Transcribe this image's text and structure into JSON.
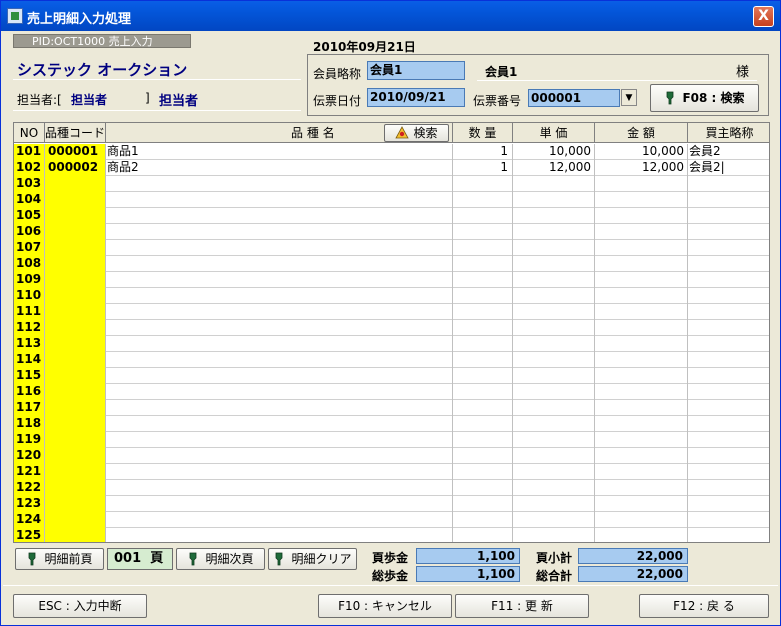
{
  "window": {
    "title": "売上明細入力処理",
    "close_label": "X"
  },
  "pid_label": "PID:OCT1000 売上入力",
  "company_name": "システック オークション",
  "tanto": {
    "label": "担当者:[",
    "code": "担当者",
    "bracket": "]",
    "name": "担当者"
  },
  "date_heading": "2010年09月21日",
  "member": {
    "label": "会員略称",
    "value": "会員1",
    "display_name": "会員1",
    "suffix": "様"
  },
  "slip": {
    "date_label": "伝票日付",
    "date_value": "2010/09/21",
    "number_label": "伝票番号",
    "number_value": "000001"
  },
  "f08_button": "F08 : 検索",
  "grid": {
    "headers": {
      "no": "NO",
      "code": "品種コード",
      "name": "品 種 名",
      "search": "検索",
      "qty": "数 量",
      "price": "単 価",
      "amount": "金 額",
      "buyer": "買主略称"
    },
    "rows": [
      {
        "no": "101",
        "code": "000001",
        "name": "商品1",
        "qty": "1",
        "price": "10,000",
        "amount": "10,000",
        "buyer": "会員2"
      },
      {
        "no": "102",
        "code": "000002",
        "name": "商品2",
        "qty": "1",
        "price": "12,000",
        "amount": "12,000",
        "buyer": "会員2|"
      },
      {
        "no": "103"
      },
      {
        "no": "104"
      },
      {
        "no": "105"
      },
      {
        "no": "106"
      },
      {
        "no": "107"
      },
      {
        "no": "108"
      },
      {
        "no": "109"
      },
      {
        "no": "110"
      },
      {
        "no": "111"
      },
      {
        "no": "112"
      },
      {
        "no": "113"
      },
      {
        "no": "114"
      },
      {
        "no": "115"
      },
      {
        "no": "116"
      },
      {
        "no": "117"
      },
      {
        "no": "118"
      },
      {
        "no": "119"
      },
      {
        "no": "120"
      },
      {
        "no": "121"
      },
      {
        "no": "122"
      },
      {
        "no": "123"
      },
      {
        "no": "124"
      },
      {
        "no": "125"
      }
    ]
  },
  "pager": {
    "prev_label": "明細前頁",
    "page_value": "001",
    "page_unit": "頁",
    "next_label": "明細次頁",
    "clear_label": "明細クリア"
  },
  "totals": {
    "page_discount_label": "頁歩金",
    "page_discount_value": "1,100",
    "page_subtotal_label": "頁小計",
    "page_subtotal_value": "22,000",
    "total_discount_label": "総歩金",
    "total_discount_value": "1,100",
    "grand_total_label": "総合計",
    "grand_total_value": "22,000"
  },
  "footer": {
    "esc_label": "ESC : 入力中断",
    "f10_label": "F10 : キャンセル",
    "f11_label": "F11 : 更 新",
    "f12_label": "F12 : 戻 る"
  },
  "colors": {
    "title_bar": "#0355d8",
    "field_bg": "#a7cbf0",
    "row_highlight": "#ffff00",
    "accent_text": "#000080"
  }
}
